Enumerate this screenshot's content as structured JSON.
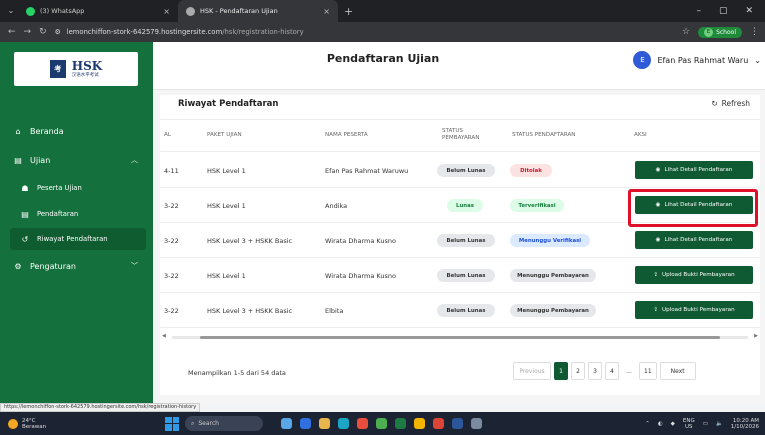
{
  "browser": {
    "tabs": [
      {
        "title": "(3) WhatsApp",
        "active": false
      },
      {
        "title": "HSK - Pendaftaran Ujian",
        "active": true
      }
    ],
    "url_site": "lemonchiffon-stork-642579.hostingersite.com",
    "url_path": "/hsk/registration-history",
    "profile_label": "School",
    "profile_initial": "E",
    "status_url": "https://lemonchiffon-stork-642579.hostingersite.com/hsk/registration-history"
  },
  "sidebar": {
    "logo_text": "HSK",
    "logo_sub": "汉语水平考试",
    "items": [
      {
        "label": "Beranda",
        "icon": "home-icon"
      },
      {
        "label": "Ujian",
        "icon": "clipboard-icon"
      },
      {
        "label": "Peserta Ujian",
        "icon": "user-icon"
      },
      {
        "label": "Pendaftaran",
        "icon": "clipboard-icon"
      },
      {
        "label": "Riwayat Pendaftaran",
        "icon": "history-icon"
      },
      {
        "label": "Pengaturan",
        "icon": "gear-icon"
      }
    ]
  },
  "header": {
    "title": "Pendaftaran Ujian",
    "user_name": "Efan Pas Rahmat Waru",
    "user_initial": "E"
  },
  "card": {
    "title": "Riwayat Pendaftaran",
    "refresh_label": "Refresh"
  },
  "table": {
    "headers": {
      "date": "AL",
      "paket": "PAKET UJIAN",
      "nama": "NAMA PESERTA",
      "status_bayar": "STATUS PEMBAYARAN",
      "status_daftar": "STATUS PENDAFTARAN",
      "aksi": "AKSI"
    },
    "rows": [
      {
        "date": "4-11",
        "paket": "HSK Level 1",
        "nama": "Efan Pas Rahmat Waruwu",
        "status_bayar": "Belum Lunas",
        "status_daftar": "Ditolak",
        "aksi": "Lihat Detail Pendaftaran"
      },
      {
        "date": "3-22",
        "paket": "HSK Level 1",
        "nama": "Andika",
        "status_bayar": "Lunas",
        "status_daftar": "Terverifikasi",
        "aksi": "Lihat Detail Pendaftaran"
      },
      {
        "date": "3-22",
        "paket": "HSK Level 3 + HSKK Basic",
        "nama": "Wirata Dharma Kusno",
        "status_bayar": "Belum Lunas",
        "status_daftar": "Menunggu Verifikasi",
        "aksi": "Lihat Detail Pendaftaran"
      },
      {
        "date": "3-22",
        "paket": "HSK Level 1",
        "nama": "Wirata Dharma Kusno",
        "status_bayar": "Belum Lunas",
        "status_daftar": "Menunggu Pembayaran",
        "aksi": "Upload Bukti Pembayaran"
      },
      {
        "date": "3-22",
        "paket": "HSK Level 3 + HSKK Basic",
        "nama": "Elbita",
        "status_bayar": "Belum Lunas",
        "status_daftar": "Menunggu Pembayaran",
        "aksi": "Upload Bukti Pembayaran"
      }
    ]
  },
  "pagination": {
    "info": "Menampilkan 1-5 dari 54 data",
    "previous": "Previous",
    "pages": [
      "1",
      "2",
      "3",
      "4",
      "...",
      "11"
    ],
    "next": "Next"
  },
  "taskbar": {
    "temp": "24°C",
    "weather": "Berawan",
    "search": "Search",
    "lang": "ENG",
    "region": "US",
    "time": "10:20 AM",
    "date": "1/10/2026"
  },
  "colors": {
    "sidebar_green": "#14713d",
    "button_green": "#0f5a33",
    "highlight_red": "#e0102a"
  }
}
